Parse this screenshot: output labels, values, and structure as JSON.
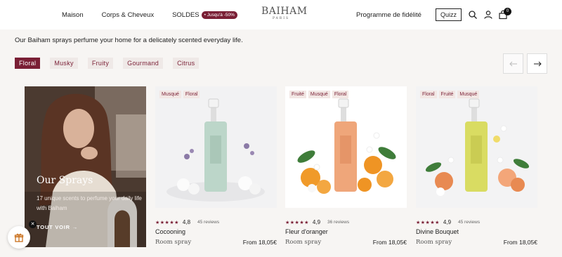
{
  "header": {
    "nav_left": [
      {
        "label": "Maison"
      },
      {
        "label": "Corps & Cheveux"
      }
    ],
    "sale": {
      "label": "SOLDES",
      "badge": "• Jusqu'à -50%"
    },
    "logo": {
      "main": "BAIHAM",
      "sub": "PARIS"
    },
    "loyalty": "Programme de fidélité",
    "quizz": "Quizz",
    "cart_count": "0",
    "icons": [
      "search-icon",
      "account-icon",
      "cart-icon"
    ]
  },
  "intro": "Our Baiham sprays perfume your home for a delicately scented everyday life.",
  "filters": [
    "Floral",
    "Musky",
    "Fruity",
    "Gourmand",
    "Citrus"
  ],
  "active_filter": "Floral",
  "promo": {
    "title": "Our Sprays",
    "subtitle": "17 unique scents to perfume your daily life with Baiham",
    "link": "TOUT VOIR →"
  },
  "products": [
    {
      "tags": [
        "Musqué",
        "Floral"
      ],
      "stars": "★★★★★",
      "rating": "4,8",
      "reviews": "45 reviews",
      "name": "Cocooning",
      "type": "Room spray",
      "price": "From 18,05€",
      "liquid": "#bcd6c9"
    },
    {
      "tags": [
        "Fruité",
        "Musqué",
        "Floral"
      ],
      "stars": "★★★★★",
      "rating": "4,9",
      "reviews": "36 reviews",
      "name": "Fleur d'oranger",
      "type": "Room spray",
      "price": "From 18,05€",
      "liquid": "#efa67a"
    },
    {
      "tags": [
        "Floral",
        "Fruité",
        "Musqué"
      ],
      "stars": "★★★★★",
      "rating": "4,9",
      "reviews": "45 reviews",
      "name": "Divine Bouquet",
      "type": "Room spray",
      "price": "From 18,05€",
      "liquid": "#d9dc62"
    }
  ],
  "colors": {
    "brand": "#7a1f35",
    "chip_bg": "#efe9e7"
  }
}
